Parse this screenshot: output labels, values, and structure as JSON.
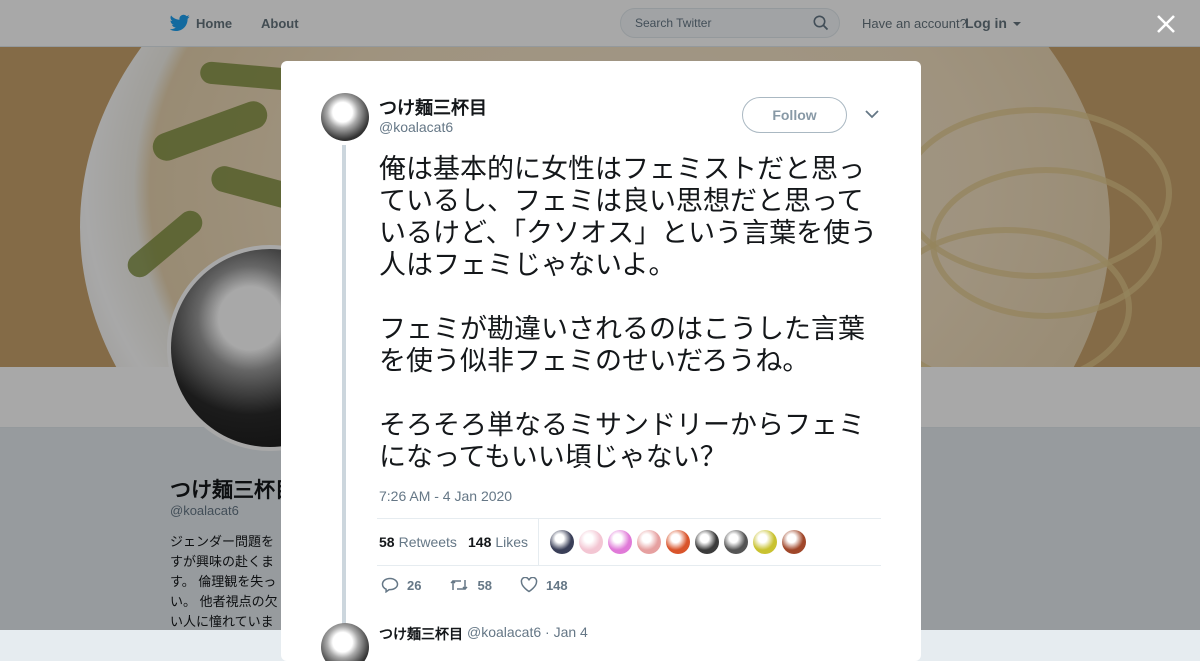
{
  "nav": {
    "home_label": "Home",
    "about_label": "About",
    "search_placeholder": "Search Twitter",
    "account_prompt": "Have an account?",
    "login_label": "Log in"
  },
  "profile": {
    "name": "つけ麺三杯目",
    "handle": "@koalacat6",
    "bio": "ジェンダー問題を\nすが興味の赴くま\nす。 倫理観を失っ\nい。 他者視点の欠\nい人に憧れていま"
  },
  "tweet": {
    "author_name": "つけ麺三杯目",
    "author_handle": "@koalacat6",
    "follow_label": "Follow",
    "text": "俺は基本的に女性はフェミストだと思っているし、フェミは良い思想だと思っているけど、「クソオス」という言葉を使う人はフェミじゃないよ。\n\nフェミが勘違いされるのはこうした言葉を使う似非フェミのせいだろうね。\n\nそろそろ単なるミサンドリーからフェミになってもいい頃じゃない？",
    "timestamp": "7:26 AM - 4 Jan 2020",
    "retweets_count": "58",
    "retweets_label": "Retweets",
    "likes_count": "148",
    "likes_label": "Likes",
    "reply_count": "26",
    "retweet_action_count": "58",
    "like_action_count": "148"
  },
  "likers": [
    {
      "color": "#3a3f58"
    },
    {
      "color": "#f3c6d3"
    },
    {
      "color": "#e07ad8"
    },
    {
      "color": "#e6a0a0"
    },
    {
      "color": "#d9542b"
    },
    {
      "color": "#3b3b3b"
    },
    {
      "color": "#555555"
    },
    {
      "color": "#c9c230"
    },
    {
      "color": "#a0472a"
    }
  ],
  "next_tweet": {
    "name": "つけ麺三杯目",
    "meta": "@koalacat6 · Jan 4"
  },
  "colors": {
    "twitter_blue": "#1da1f2",
    "text_primary": "#14171a",
    "text_secondary": "#657786"
  }
}
